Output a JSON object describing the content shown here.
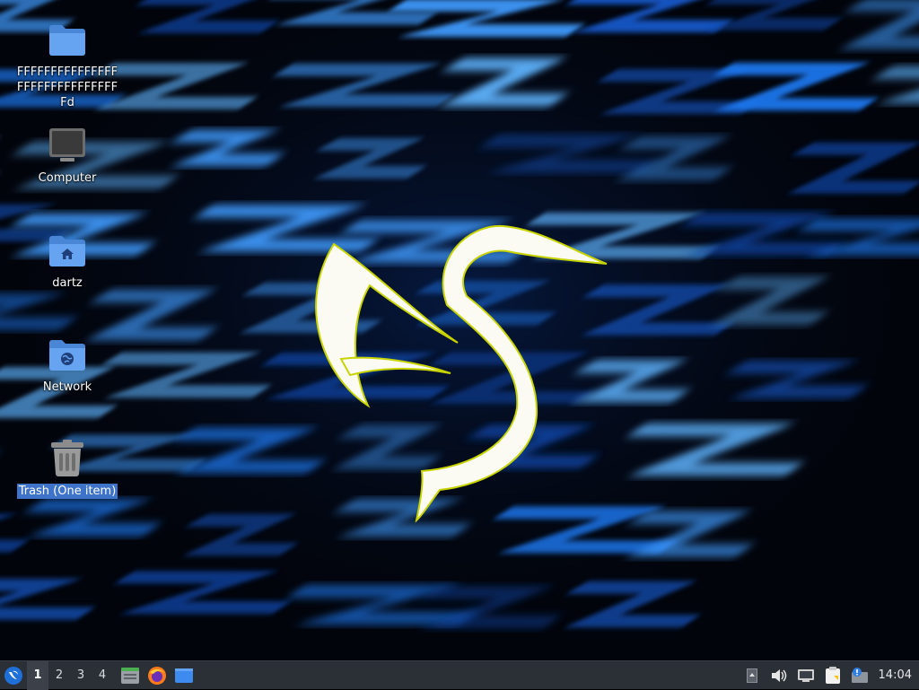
{
  "desktop": {
    "icons": [
      {
        "label": "FFFFFFFFFFFFFFFFFFFFFFFFFFFFFFFd",
        "icon": "folder-icon"
      },
      {
        "label": "Computer",
        "icon": "computer-icon"
      },
      {
        "label": "dartz",
        "icon": "home-folder-icon"
      },
      {
        "label": "Network",
        "icon": "network-folder-icon"
      },
      {
        "label": "Trash (One item)",
        "icon": "trash-icon",
        "selected": true
      }
    ],
    "wallpaper": {
      "icon": "lubuntu-bird-logo",
      "accent": "#2a8cff"
    }
  },
  "taskbar": {
    "workspaces": [
      "1",
      "2",
      "3",
      "4"
    ],
    "active_workspace": "1",
    "launchers": [
      {
        "icon": "file-manager-icon"
      },
      {
        "icon": "firefox-icon"
      },
      {
        "icon": "show-desktop-icon"
      }
    ],
    "tray": [
      {
        "icon": "tray-up-icon"
      },
      {
        "icon": "volume-icon"
      },
      {
        "icon": "network-connection-icon"
      },
      {
        "icon": "clipboard-icon"
      },
      {
        "icon": "update-notifier-icon"
      }
    ],
    "clock": "14:04"
  },
  "colors": {
    "taskbar_bg": "#2b2f36",
    "selection": "#3d73c8",
    "folder_blue": "#5b9bea"
  }
}
